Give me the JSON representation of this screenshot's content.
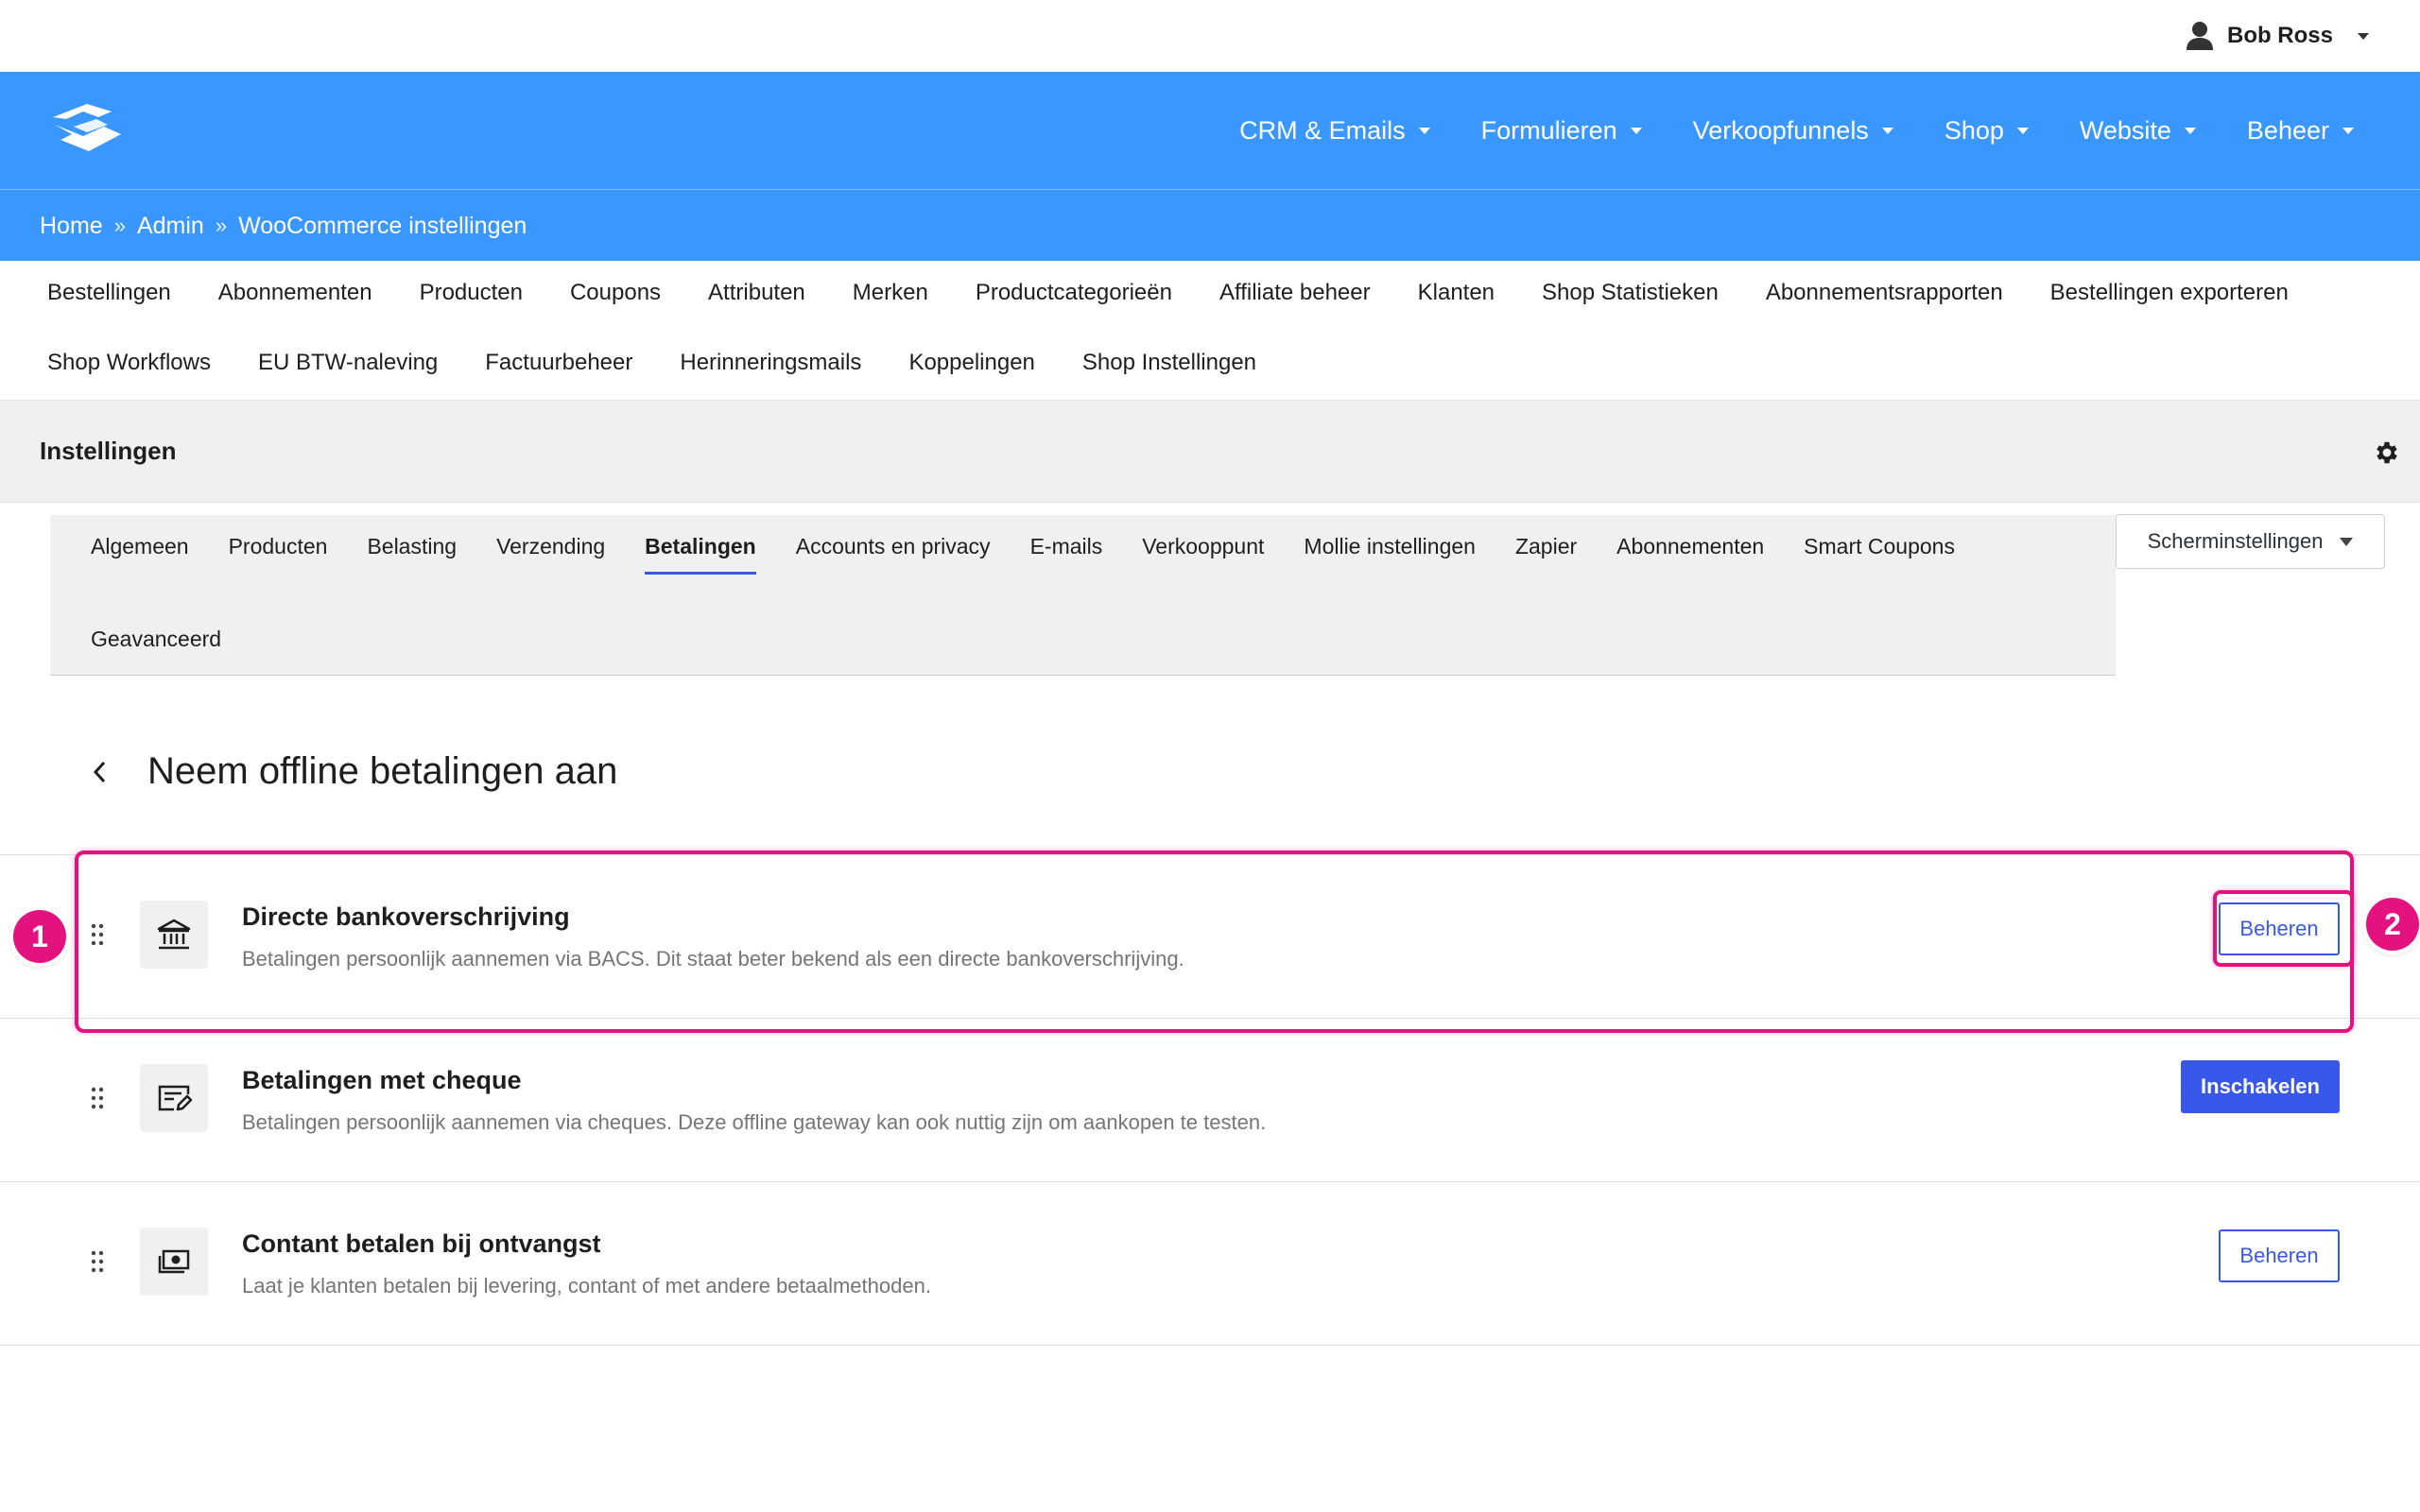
{
  "user": {
    "name": "Bob Ross"
  },
  "main_menu": [
    {
      "label": "CRM & Emails"
    },
    {
      "label": "Formulieren"
    },
    {
      "label": "Verkoopfunnels"
    },
    {
      "label": "Shop"
    },
    {
      "label": "Website"
    },
    {
      "label": "Beheer"
    }
  ],
  "breadcrumb": {
    "items": [
      "Home",
      "Admin",
      "WooCommerce instellingen"
    ],
    "separator": "»"
  },
  "shop_menu": {
    "row1": [
      "Bestellingen",
      "Abonnementen",
      "Producten",
      "Coupons",
      "Attributen",
      "Merken",
      "Productcategorieën",
      "Affiliate beheer",
      "Klanten",
      "Shop Statistieken",
      "Abonnementsrapporten",
      "Bestellingen exporteren"
    ],
    "row2": [
      "Shop Workflows",
      "EU BTW-naleving",
      "Factuurbeheer",
      "Herinneringsmails",
      "Koppelingen",
      "Shop Instellingen"
    ]
  },
  "settings": {
    "title": "Instellingen"
  },
  "tabs": {
    "row1": [
      "Algemeen",
      "Producten",
      "Belasting",
      "Verzending",
      "Betalingen",
      "Accounts en privacy",
      "E-mails",
      "Verkooppunt",
      "Mollie instellingen",
      "Zapier",
      "Abonnementen",
      "Smart Coupons"
    ],
    "row2": [
      "Geavanceerd"
    ],
    "active": "Betalingen"
  },
  "screen_options": {
    "label": "Scherminstellingen"
  },
  "page": {
    "heading": "Neem offline betalingen aan"
  },
  "gateways": [
    {
      "title": "Directe bankoverschrijving",
      "description": "Betalingen persoonlijk aannemen via BACS. Dit staat beter bekend als een directe bankoverschrijving.",
      "button": "Beheren",
      "button_style": "outline",
      "icon": "bank-icon"
    },
    {
      "title": "Betalingen met cheque",
      "description": "Betalingen persoonlijk aannemen via cheques. Deze offline gateway kan ook nuttig zijn om aankopen te testen.",
      "button": "Inschakelen",
      "button_style": "primary",
      "icon": "cheque-icon"
    },
    {
      "title": "Contant betalen bij ontvangst",
      "description": "Laat je klanten betalen bij levering, contant of met andere betaalmethoden.",
      "button": "Beheren",
      "button_style": "outline",
      "icon": "cash-icon"
    }
  ],
  "annotations": {
    "marker1": "1",
    "marker2": "2"
  },
  "colors": {
    "brand_blue": "#3a97ff",
    "button_blue": "#3858e9",
    "highlight_pink": "#e3127f"
  }
}
